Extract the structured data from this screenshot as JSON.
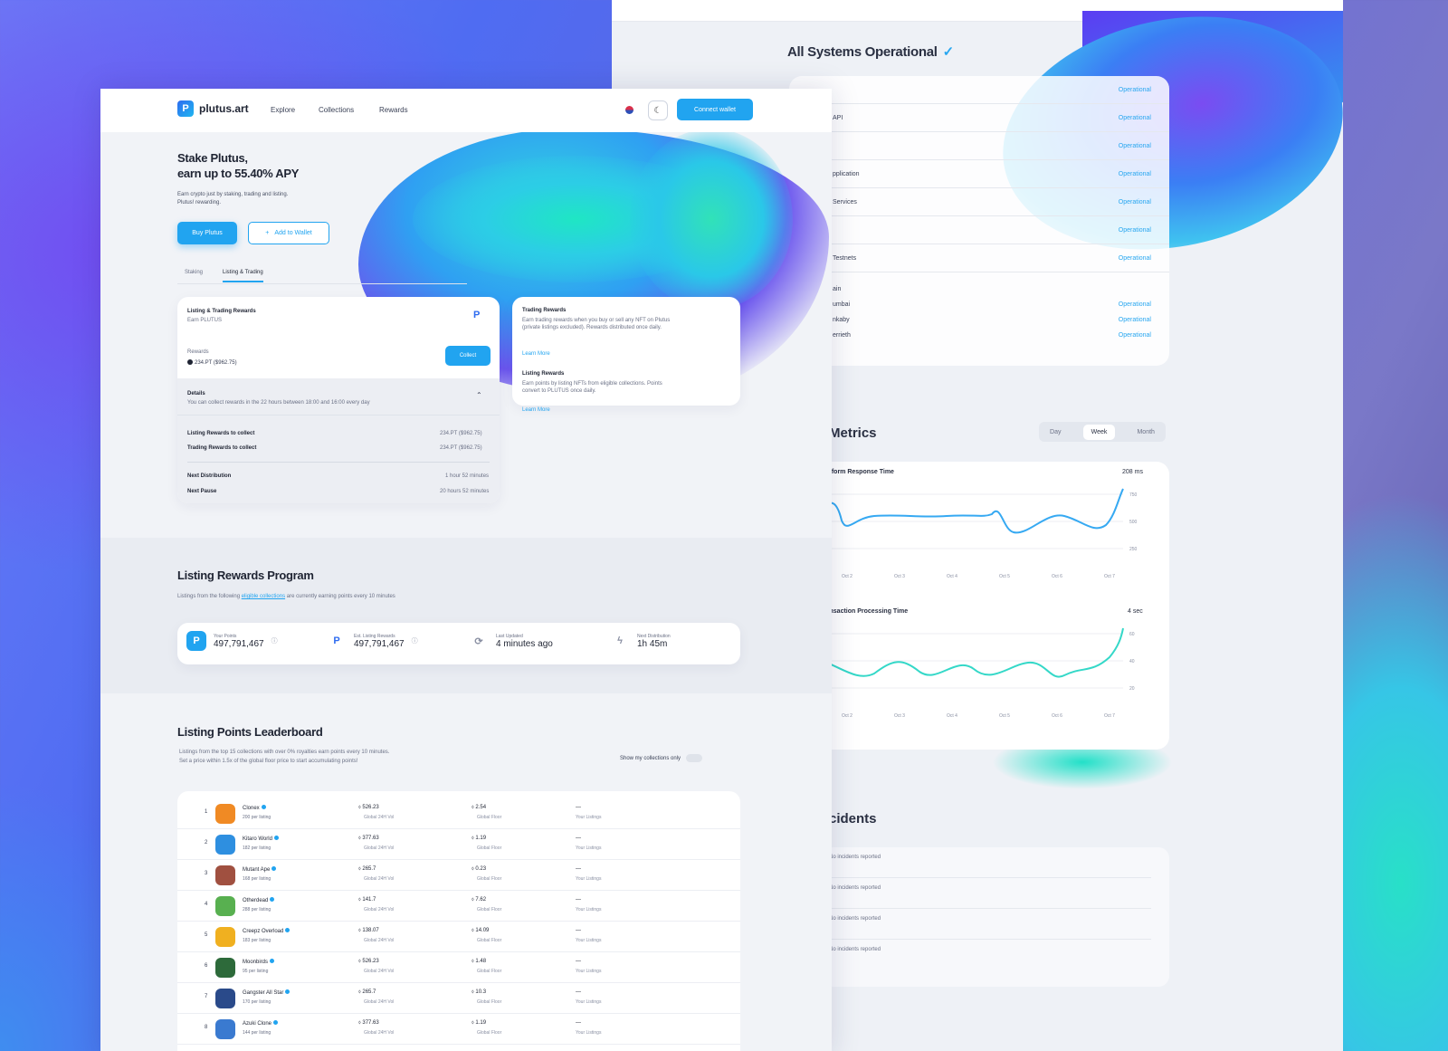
{
  "colors": {
    "accent": "#21a4f0",
    "teal": "#28e0c8",
    "violet": "#6b56ee"
  },
  "back": {
    "status_title": "All Systems Operational",
    "status_rows": [
      {
        "name": "",
        "status": "Operational"
      },
      {
        "name": "API",
        "status": "Operational"
      },
      {
        "name": "",
        "status": "Operational"
      },
      {
        "name": "pplication",
        "status": "Operational"
      },
      {
        "name": "Services",
        "status": "Operational"
      },
      {
        "name": "",
        "status": "Operational"
      },
      {
        "name": "Testnets",
        "status": "Operational"
      }
    ],
    "sub_rows": [
      {
        "name": "ain",
        "status": ""
      },
      {
        "name": "umbai",
        "status": "Operational"
      },
      {
        "name": "nkaby",
        "status": "Operational"
      },
      {
        "name": "errieth",
        "status": "Operational"
      }
    ],
    "metrics_title": "Metrics",
    "segments": [
      "Day",
      "Week",
      "Month"
    ],
    "chart1": {
      "label": "Platform Response Time",
      "value": "208 ms",
      "yticks": [
        "750",
        "500",
        "250"
      ],
      "xticks": [
        "Oct 2",
        "Oct 3",
        "Oct 4",
        "Oct 5",
        "Oct 6",
        "Oct 7"
      ]
    },
    "chart2": {
      "label": "Transaction Processing Time",
      "value": "4 sec",
      "yticks": [
        "60",
        "40",
        "20"
      ],
      "xticks": [
        "Oct 2",
        "Oct 3",
        "Oct 4",
        "Oct 5",
        "Oct 6",
        "Oct 7"
      ]
    },
    "incidents_title": "cidents",
    "incidents": [
      "No incidents reported",
      "No incidents reported",
      "No incidents reported",
      "No incidents reported"
    ]
  },
  "nav": {
    "brand": "plutus.art",
    "links": [
      "Explore",
      "Collections",
      "Rewards"
    ],
    "connect": "Connect wallet"
  },
  "hero": {
    "title_line1": "Stake Plutus,",
    "title_line2": "earn up to 55.40% APY",
    "subtitle": "Earn crypto just by staking, trading and listing. Plutus! rewarding.",
    "buy": "Buy Plutus",
    "add": "Add to Wallet"
  },
  "tabs": [
    "Staking",
    "Listing & Trading"
  ],
  "rewards_card": {
    "title": "Listing & Trading Rewards",
    "subtitle": "Earn PLUTUS",
    "rewards_label": "Rewards",
    "rewards_value": "234.PT ($962.75)",
    "collect": "Collect",
    "details_label": "Details",
    "details_text": "You can collect rewards in the 22 hours between 18:00 and 16:00 every day",
    "rows": [
      {
        "label": "Listing Rewards to collect",
        "value": "234.PT ($962.75)"
      },
      {
        "label": "Trading Rewards to collect",
        "value": "234.PT ($962.75)"
      },
      {
        "label": "Next Distribution",
        "value": "1 hour 52 minutes"
      },
      {
        "label": "Next Pause",
        "value": "20 hours 52 minutes"
      }
    ]
  },
  "info_card": {
    "t1": "Trading Rewards",
    "d1": "Earn trading rewards when you buy or sell any NFT on Plutus (private listings excluded). Rewards distributed once daily.",
    "l1": "Learn More",
    "t2": "Listing Rewards",
    "d2": "Earn points by listing NFTs from eligible collections. Points convert to PLUTUS once daily.",
    "l2": "Learn More"
  },
  "program": {
    "title": "Listing Rewards Program",
    "desc_before": "Listings from the following ",
    "desc_link": "eligible collections",
    "desc_after": " are currently earning points every 10 minutes",
    "stats": [
      {
        "label": "Your Points",
        "value": "497,791,467"
      },
      {
        "label": "Est. Listing Rewards",
        "value": "497,791,467"
      },
      {
        "label": "Last Updated",
        "value": "4 minutes ago"
      },
      {
        "label": "Next Distribution",
        "value": "1h 45m"
      }
    ]
  },
  "leaderboard": {
    "title": "Listing Points Leaderboard",
    "desc1": "Listings from the top 15 collections with over 0% royalties earn points every 10 minutes.",
    "desc2": "Set a price within 1.5x of the global floor price to start accumulating points!",
    "toggle": "Show my collections only",
    "col_a": "Global 24H Vol",
    "col_b": "Global Floor",
    "col_c": "Your Listings",
    "rows": [
      {
        "rank": "1",
        "name": "Clonex",
        "per": "200 per listing",
        "vol": "526.23",
        "floor": "2.54",
        "yours": "—",
        "color": "#f08a24"
      },
      {
        "rank": "2",
        "name": "Kitaro World",
        "per": "182 per listing",
        "vol": "377.63",
        "floor": "1.19",
        "yours": "—",
        "color": "#2e8fe0"
      },
      {
        "rank": "3",
        "name": "Mutant Ape",
        "per": "168 per listing",
        "vol": "265.7",
        "floor": "0.23",
        "yours": "—",
        "color": "#a05040"
      },
      {
        "rank": "4",
        "name": "Otherdead",
        "per": "288 per listing",
        "vol": "141.7",
        "floor": "7.62",
        "yours": "—",
        "color": "#58b050"
      },
      {
        "rank": "5",
        "name": "Creepz Overload",
        "per": "183 per listing",
        "vol": "138.07",
        "floor": "14.09",
        "yours": "—",
        "color": "#f0b020"
      },
      {
        "rank": "6",
        "name": "Moonbirds",
        "per": "95 per listing",
        "vol": "526.23",
        "floor": "1.48",
        "yours": "—",
        "color": "#2d6a3a"
      },
      {
        "rank": "7",
        "name": "Gangster All Star",
        "per": "170 per listing",
        "vol": "265.7",
        "floor": "10.3",
        "yours": "—",
        "color": "#2a4a8a"
      },
      {
        "rank": "8",
        "name": "Azuki Clone",
        "per": "144 per listing",
        "vol": "377.63",
        "floor": "1.19",
        "yours": "—",
        "color": "#3a7ad0"
      }
    ]
  }
}
